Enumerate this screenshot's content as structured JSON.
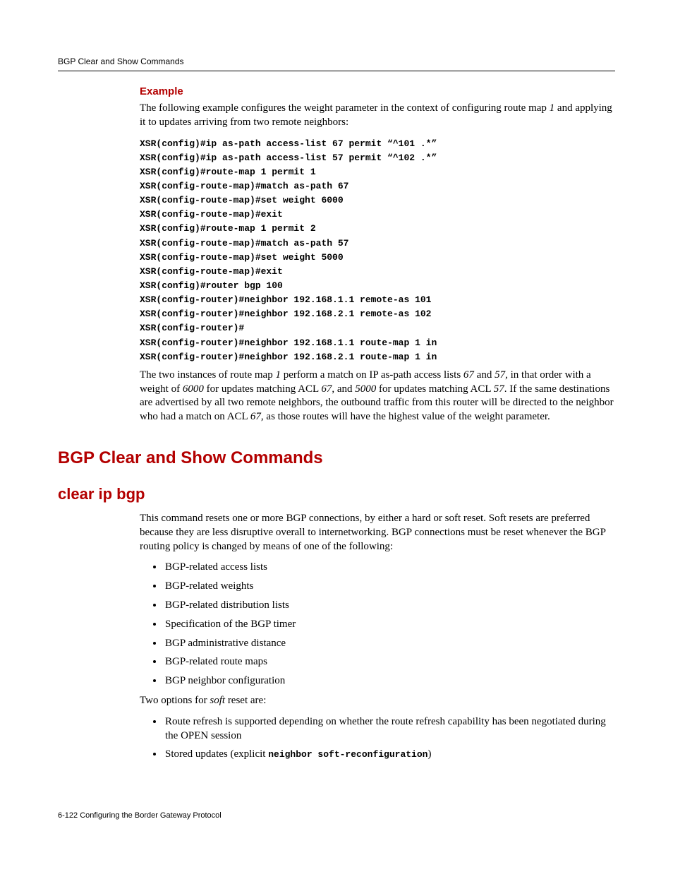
{
  "runningHead": "BGP Clear and Show Commands",
  "example": {
    "heading": "Example",
    "intro_pre": "The following example configures the weight parameter in the context of configuring route map ",
    "intro_rm": "1",
    "intro_post": " and applying it to updates arriving from two remote neighbors:",
    "code": "XSR(config)#ip as-path access-list 67 permit “^101 .*”\nXSR(config)#ip as-path access-list 57 permit “^102 .*”\nXSR(config)#route-map 1 permit 1\nXSR(config-route-map)#match as-path 67\nXSR(config-route-map)#set weight 6000\nXSR(config-route-map)#exit\nXSR(config)#route-map 1 permit 2\nXSR(config-route-map)#match as-path 57\nXSR(config-route-map)#set weight 5000\nXSR(config-route-map)#exit\nXSR(config)#router bgp 100\nXSR(config-router)#neighbor 192.168.1.1 remote-as 101\nXSR(config-router)#neighbor 192.168.2.1 remote-as 102\nXSR(config-router)#\nXSR(config-router)#neighbor 192.168.1.1 route-map 1 in\nXSR(config-router)#neighbor 192.168.2.1 route-map 1 in",
    "post": {
      "p1": "The two instances of route map ",
      "rm": "1",
      "p2": " perform a match on IP as-path access lists ",
      "acl67a": "67",
      "p3": " and ",
      "acl57a": "57",
      "p4": ", in that order with a weight of ",
      "w6000": "6000",
      "p5": " for updates matching ACL ",
      "acl67b": "67",
      "p6": ", and ",
      "w5000": "5000",
      "p7": " for updates matching ACL ",
      "acl57b": "57",
      "p8": ". If the same destinations are advertised by all two remote neighbors, the outbound traffic from this router will be directed to the neighbor who had a match on ACL ",
      "acl67c": "67",
      "p9": ", as those routes will have the highest value of the weight parameter."
    }
  },
  "section": {
    "h1": "BGP Clear and Show Commands",
    "h2": "clear ip bgp",
    "intro": "This command resets one or more BGP connections, by either a hard or soft reset. Soft resets are preferred because they are less disruptive overall to internetworking. BGP connections must be reset whenever the BGP routing policy is changed by means of one of the following:",
    "bullets1": [
      "BGP-related access lists",
      "BGP-related weights",
      "BGP-related distribution lists",
      "Specification of the BGP timer",
      "BGP administrative distance",
      "BGP-related route maps",
      "BGP neighbor configuration"
    ],
    "softIntro_pre": "Two options for ",
    "softIntro_em": "soft",
    "softIntro_post": " reset are:",
    "bullets2": {
      "b1": "Route refresh is supported depending on whether the route refresh capability has been negotiated during the OPEN session",
      "b2_pre": "Stored updates (explicit ",
      "b2_code": "neighbor soft-reconfiguration",
      "b2_post": ")"
    }
  },
  "footer": "6-122   Configuring the Border Gateway Protocol"
}
